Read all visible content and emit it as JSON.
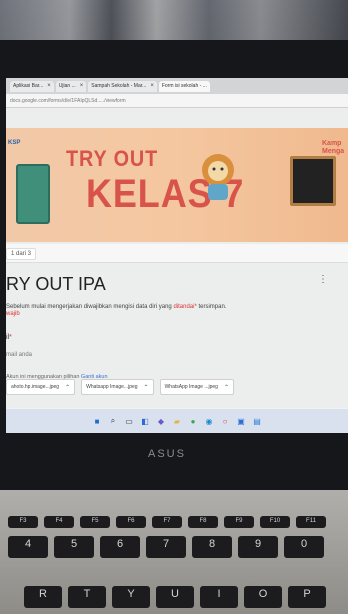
{
  "browser": {
    "tabs": [
      {
        "label": "Aplikasi Bar...",
        "active": false
      },
      {
        "label": "Ujian ...",
        "active": false
      },
      {
        "label": "Sampah Sekolah - Mar...",
        "active": false
      },
      {
        "label": "Form isi sekolah - ...",
        "active": true
      }
    ],
    "address": "docs.google.com/forms/d/e/1FAIpQLSd...../viewform"
  },
  "banner": {
    "logo": "KSP",
    "title_line1": "TRY OUT",
    "title_line2": "KELAS 7",
    "side_text": "Kamp Menga"
  },
  "section_tab": "1 dari 3",
  "form": {
    "title": "RY OUT IPA",
    "description_prefix": "Sebelum mulai mengerjakan diwajibkan mengisi data diri yang ",
    "description_red": "ditandai*",
    "description_suffix": " tersimpan.",
    "required_prefix": "",
    "required_red": "wajib",
    "email_label": "il",
    "email_required_mark": "*",
    "email_hint": "mail anda",
    "note_text": "Akun ini menggunakan pilihan ",
    "note_link": "Ganti akun",
    "files": [
      {
        "label": "ahoto.hp.image...jpeg"
      },
      {
        "label": "Whatsapp Image...jpeg"
      },
      {
        "label": "WhatsApp Image ...jpeg"
      }
    ]
  },
  "taskbar": {
    "icons": [
      {
        "name": "windows-start-icon",
        "color": "#1f6fd1"
      },
      {
        "name": "search-icon",
        "color": "#333333"
      },
      {
        "name": "task-view-icon",
        "color": "#333333"
      },
      {
        "name": "widgets-icon",
        "color": "#2b6bd6"
      },
      {
        "name": "chat-icon",
        "color": "#6a5acd"
      },
      {
        "name": "file-explorer-icon",
        "color": "#e3b341"
      },
      {
        "name": "chrome-icon",
        "color": "#3aa55d"
      },
      {
        "name": "edge-icon",
        "color": "#1d8bd1"
      },
      {
        "name": "opera-icon",
        "color": "#d93b3b"
      },
      {
        "name": "store-icon",
        "color": "#2a6ed6"
      },
      {
        "name": "photos-icon",
        "color": "#2a7ad6"
      }
    ]
  },
  "laptop_brand": "ASUS",
  "keyboard": {
    "fn_row": [
      "F3",
      "F4",
      "F5",
      "F6",
      "F7",
      "F8",
      "F9",
      "F10",
      "F11"
    ],
    "num_row": [
      "4",
      "5",
      "6",
      "7",
      "8",
      "9",
      "0"
    ],
    "alpha_row": [
      "R",
      "T",
      "Y",
      "U",
      "I",
      "O",
      "P"
    ]
  }
}
